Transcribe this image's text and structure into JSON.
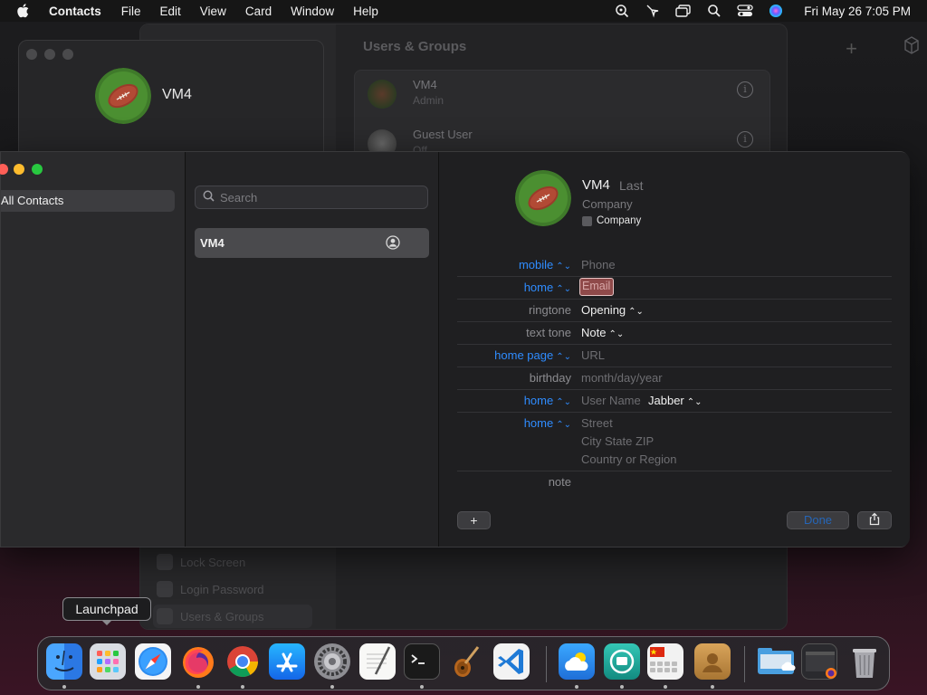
{
  "menubar": {
    "app_name": "Contacts",
    "items": [
      "File",
      "Edit",
      "View",
      "Card",
      "Window",
      "Help"
    ],
    "clock": "Fri May 26  7:05 PM"
  },
  "settings_window": {
    "title": "Users & Groups",
    "users": [
      {
        "name": "VM4",
        "role": "Admin"
      },
      {
        "name": "Guest User",
        "role": "Off"
      }
    ],
    "sidebar_items": [
      "Lock Screen",
      "Login Password",
      "Users & Groups"
    ]
  },
  "contacts_bg": {
    "name": "VM4"
  },
  "contacts": {
    "groups": [
      "All Contacts"
    ],
    "search_placeholder": "Search",
    "list": [
      "VM4"
    ],
    "card": {
      "first_name": "VM4",
      "last_name": "Last",
      "company": "Company",
      "company_checkbox_label": "Company",
      "fields": [
        {
          "label": "mobile",
          "value": "Phone",
          "label_style": "blue",
          "value_style": "placeholder"
        },
        {
          "label": "home",
          "value": "Email",
          "label_style": "blue",
          "value_style": "focus"
        },
        {
          "label": "ringtone",
          "value": "Opening",
          "label_style": "grey",
          "value_style": "strong"
        },
        {
          "label": "text tone",
          "value": "Note",
          "label_style": "grey",
          "value_style": "strong"
        },
        {
          "label": "home page",
          "value": "URL",
          "label_style": "blue",
          "value_style": "placeholder"
        },
        {
          "label": "birthday",
          "value": "month/day/year",
          "label_style": "grey",
          "value_style": "placeholder"
        },
        {
          "label": "home",
          "value": "User Name",
          "extra": "Jabber",
          "label_style": "blue",
          "value_style": "placeholder"
        },
        {
          "label": "home",
          "value": "Street",
          "line2": "City State ZIP",
          "line3": "Country or Region",
          "label_style": "blue",
          "value_style": "placeholder"
        },
        {
          "label": "note",
          "value": "",
          "label_style": "grey",
          "value_style": "placeholder"
        }
      ],
      "add_label": "+",
      "done_label": "Done"
    }
  },
  "dock": {
    "tooltip": "Launchpad",
    "apps": [
      "Finder",
      "Launchpad",
      "Safari",
      "Firefox",
      "Chrome",
      "App Store",
      "System Settings",
      "TextEdit",
      "Terminal",
      "Instruments",
      "Visual Studio Code",
      "Weather",
      "Screen Share",
      "Input Source",
      "Contacts",
      "Downloads",
      "Firefox Window",
      "Trash"
    ]
  },
  "colors": {
    "accent_blue": "#2f8cff",
    "close": "#fe5f57",
    "minimize": "#febc2e",
    "zoom": "#28c840"
  }
}
